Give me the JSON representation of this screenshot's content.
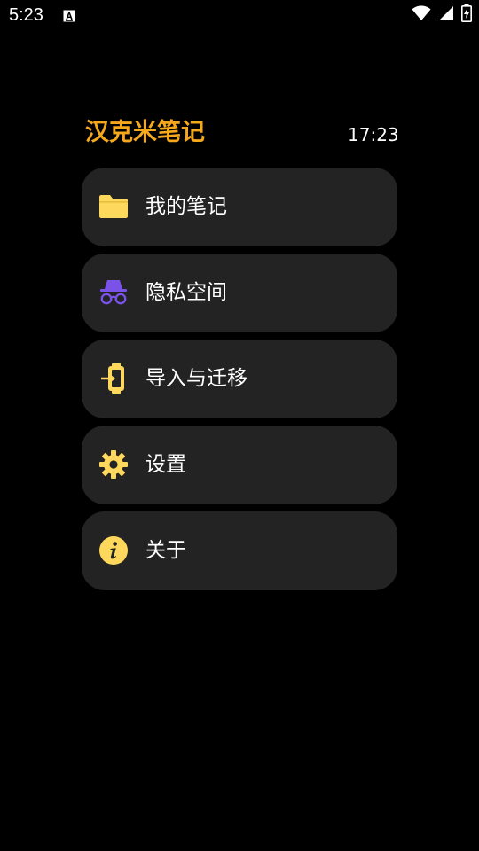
{
  "status_bar": {
    "time": "5:23",
    "icons": [
      "notification-a-icon",
      "wifi-icon",
      "cellular-icon",
      "battery-charging-icon"
    ]
  },
  "header": {
    "title": "汉克米笔记",
    "clock": "17:23"
  },
  "menu": {
    "items": [
      {
        "label": "我的笔记",
        "icon": "folder-icon",
        "icon_color": "#fdd85d"
      },
      {
        "label": "隐私空间",
        "icon": "incognito-icon",
        "icon_color": "#7b52e8"
      },
      {
        "label": "导入与迁移",
        "icon": "import-device-icon",
        "icon_color": "#fdd85d"
      },
      {
        "label": "设置",
        "icon": "gear-icon",
        "icon_color": "#fdd85d"
      },
      {
        "label": "关于",
        "icon": "info-icon",
        "icon_color": "#fdd85d"
      }
    ]
  },
  "colors": {
    "background": "#000000",
    "card": "#232323",
    "accent": "#f6a81c",
    "icon_yellow": "#fdd85d",
    "icon_purple": "#7b52e8"
  }
}
